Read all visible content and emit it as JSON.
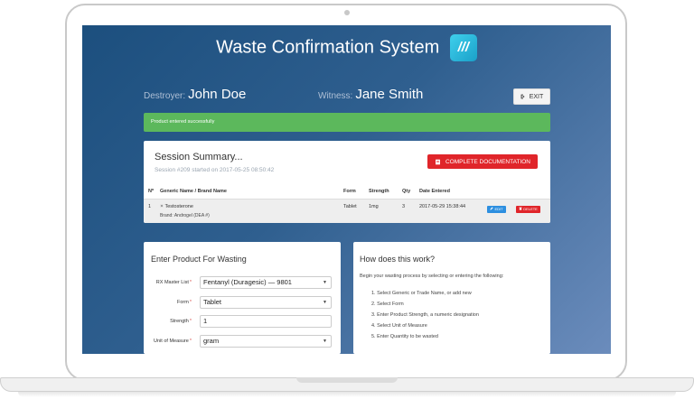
{
  "app": {
    "title": "Waste Confirmation System",
    "logo_text": "///"
  },
  "header": {
    "destroyer_label": "Destroyer:",
    "destroyer_name": "John Doe",
    "witness_label": "Witness:",
    "witness_name": "Jane Smith",
    "exit_label": "EXIT"
  },
  "alert": {
    "text": "Product entered successfully"
  },
  "session": {
    "title": "Session Summary...",
    "subtitle": "Session #209 started on 2017-05-25 08:50:42",
    "complete_label": "COMPLETE DOCUMENTATION",
    "columns": [
      "Nº",
      "Generic Name / Brand Name",
      "Form",
      "Strength",
      "Qty",
      "Date Entered"
    ],
    "rows": [
      {
        "no": "1",
        "generic": "Testosterone",
        "brand": "Brand: Androgel (DEA #)",
        "form": "Tablet",
        "strength": "1mg",
        "qty": "3",
        "date": "2017-05-29 15:38:44",
        "edit_label": "EDIT",
        "delete_label": "DELETE"
      }
    ]
  },
  "enter": {
    "title": "Enter Product For Wasting",
    "fields": [
      {
        "label": "RX Master List",
        "value": "Fentanyl (Duragesic)  —  9801"
      },
      {
        "label": "Form",
        "value": "Tablet"
      },
      {
        "label": "Strength",
        "value": "1"
      },
      {
        "label": "Unit of Measure",
        "value": "gram"
      }
    ],
    "required_mark": "*"
  },
  "how": {
    "title": "How does this work?",
    "intro": "Begin your wasting process by selecting or entering the following:",
    "steps": [
      "1. Select Generic or Trade Name, or add new",
      "2. Select Form",
      "3. Enter Product Strength, a numeric designation",
      "4. Select Unit of Measure",
      "5. Enter Quantity to be wasted"
    ]
  },
  "icons": {
    "exit": "sign-out-icon",
    "complete": "document-icon",
    "edit": "pencil-icon",
    "delete": "trash-icon",
    "dropdown": "chevron-down-icon"
  },
  "colors": {
    "accent_red": "#e0252a",
    "success_green": "#5cb85c",
    "edit_blue": "#2d8fe0",
    "logo_cyan": "#3fd0ec"
  }
}
